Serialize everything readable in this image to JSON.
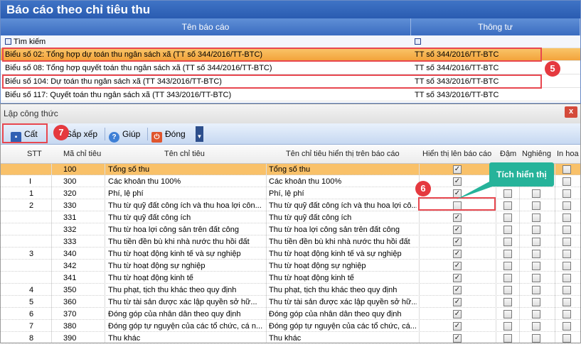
{
  "top": {
    "title": "Báo cáo theo chỉ tiêu thu",
    "col_name": "Tên báo cáo",
    "col_circular": "Thông tư",
    "search_label": "Tìm kiếm",
    "rows": [
      {
        "name": "Biểu số 02: Tổng hợp dự toán thu ngân sách xã (TT số 344/2016/TT-BTC)",
        "circular": "TT số 344/2016/TT-BTC"
      },
      {
        "name": "Biểu số 08: Tổng hợp quyết toán thu ngân sách xã (TT số 344/2016/TT-BTC)",
        "circular": "TT số 344/2016/TT-BTC"
      },
      {
        "name": "Biểu số 104: Dự toán thu ngân sách xã (TT 343/2016/TT-BTC)",
        "circular": "TT số 343/2016/TT-BTC"
      },
      {
        "name": "Biểu số 117: Quyết toán thu ngân sách xã (TT 343/2016/TT-BTC)",
        "circular": "TT số 343/2016/TT-BTC"
      }
    ]
  },
  "badges": {
    "b5": "5",
    "b6": "6",
    "b7": "7"
  },
  "formula": {
    "title": "Lập công thức",
    "close": "x",
    "toolbar": {
      "save": "Cất",
      "sort": "Sắp xếp",
      "help": "Giúp",
      "close": "Đóng"
    },
    "headers": {
      "stt": "STT",
      "code": "Mã chỉ tiêu",
      "name": "Tên chỉ tiêu",
      "display_name": "Tên chỉ tiêu hiển thị trên báo cáo",
      "show": "Hiển thị lên báo cáo",
      "bold": "Đậm",
      "italic": "Nghiêng",
      "print": "In hoa"
    },
    "callout": "Tích hiển thị",
    "rows": [
      {
        "stt": "",
        "code": "100",
        "name": "Tổng số thu",
        "display": "Tổng số thu",
        "show": true
      },
      {
        "stt": "I",
        "code": "300",
        "name": "Các khoản thu 100%",
        "display": "Các khoản thu 100%",
        "show": true
      },
      {
        "stt": "1",
        "code": "320",
        "name": "Phí, lệ phí",
        "display": "Phí, lệ phí",
        "show": true
      },
      {
        "stt": "2",
        "code": "330",
        "name": "Thu từ quỹ đất công ích và thu hoa lợi côn...",
        "display": "Thu từ quỹ đất công ích và thu hoa lợi cô...",
        "show": false
      },
      {
        "stt": "",
        "code": "331",
        "name": "Thu từ quỹ đất công ích",
        "display": "Thu từ quỹ đất công ích",
        "show": true
      },
      {
        "stt": "",
        "code": "332",
        "name": "Thu từ hoa lợi công sản trên đất công",
        "display": "Thu từ hoa lợi công sản trên đất công",
        "show": true
      },
      {
        "stt": "",
        "code": "333",
        "name": "Thu tiền đền bù khi nhà nước thu hồi đất",
        "display": "Thu tiền đền bù khi nhà nước thu hồi đất",
        "show": true
      },
      {
        "stt": "3",
        "code": "340",
        "name": "Thu từ hoạt động kinh tế và sự nghiệp",
        "display": "Thu từ hoạt động kinh tế và sự nghiệp",
        "show": true
      },
      {
        "stt": "",
        "code": "342",
        "name": "Thu từ hoạt động sự nghiệp",
        "display": "Thu từ hoạt động sự nghiệp",
        "show": true
      },
      {
        "stt": "",
        "code": "341",
        "name": "Thu từ hoạt động kinh tế",
        "display": "Thu từ hoạt động kinh tế",
        "show": true
      },
      {
        "stt": "4",
        "code": "350",
        "name": "Thu phạt, tịch thu khác theo quy định",
        "display": "Thu phạt, tịch thu khác theo quy định",
        "show": true
      },
      {
        "stt": "5",
        "code": "360",
        "name": "Thu từ tài sản được xác lập quyền sở hữ...",
        "display": "Thu từ tài sản được xác lập quyền sở hữ...",
        "show": true
      },
      {
        "stt": "6",
        "code": "370",
        "name": "Đóng góp của nhân dân theo quy định",
        "display": "Đóng góp của nhân dân theo quy định",
        "show": true
      },
      {
        "stt": "7",
        "code": "380",
        "name": "Đóng góp tự nguyện của các tổ chức, cá n...",
        "display": "Đóng góp tự nguyện của các tổ chức, cá...",
        "show": true
      },
      {
        "stt": "8",
        "code": "390",
        "name": "Thu khác",
        "display": "Thu khác",
        "show": true
      }
    ]
  }
}
